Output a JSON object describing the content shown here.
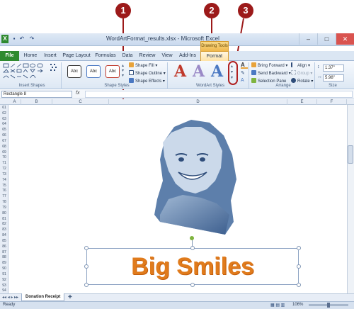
{
  "window": {
    "title": "WordArtFormat_results.xlsx - Microsoft Excel",
    "context_tab_group": "Drawing Tools",
    "controls": [
      "–",
      "□",
      "✕"
    ]
  },
  "tabs": [
    "File",
    "Home",
    "Insert",
    "Page Layout",
    "Formulas",
    "Data",
    "Review",
    "View",
    "Add-Ins",
    "Format"
  ],
  "ribbon": {
    "insert_shapes_label": "Insert Shapes",
    "shape_styles": {
      "buttons": [
        "Abc",
        "Abc",
        "Abc"
      ],
      "fill": "Shape Fill",
      "outline": "Shape Outline",
      "effects": "Shape Effects",
      "label": "Shape Styles"
    },
    "wordart_styles": {
      "letters": [
        "A",
        "A",
        "A"
      ],
      "label": "WordArt Styles"
    },
    "arrange": {
      "bring_forward": "Bring Forward",
      "send_backward": "Send Backward",
      "selection_pane": "Selection Pane",
      "align": "Align",
      "group": "Group",
      "rotate": "Rotate",
      "label": "Arrange"
    },
    "size": {
      "height": "1.37\"",
      "width": "5.98\"",
      "label": "Size"
    }
  },
  "formula_bar": {
    "name_box": "Rectangle 8",
    "fx": "fx",
    "value": ""
  },
  "columns": [
    "A",
    "B",
    "C",
    "D",
    "E",
    "F"
  ],
  "rows": [
    "61",
    "62",
    "63",
    "64",
    "65",
    "66",
    "67",
    "68",
    "69",
    "70",
    "71",
    "72",
    "73",
    "74",
    "75",
    "76",
    "77",
    "78",
    "79",
    "80",
    "81",
    "82",
    "83",
    "84",
    "85",
    "86",
    "87",
    "88",
    "89",
    "90",
    "91",
    "92",
    "93",
    "94"
  ],
  "wordart_text": "Big Smiles",
  "sheet_tab": "Donation Receipt",
  "status": {
    "ready": "Ready",
    "zoom": "106%"
  },
  "callouts": [
    "1",
    "2",
    "3"
  ],
  "colors": {
    "accent": "#2f8a2f",
    "callout": "#9c1a1a",
    "wordart": "#e07b1c"
  }
}
